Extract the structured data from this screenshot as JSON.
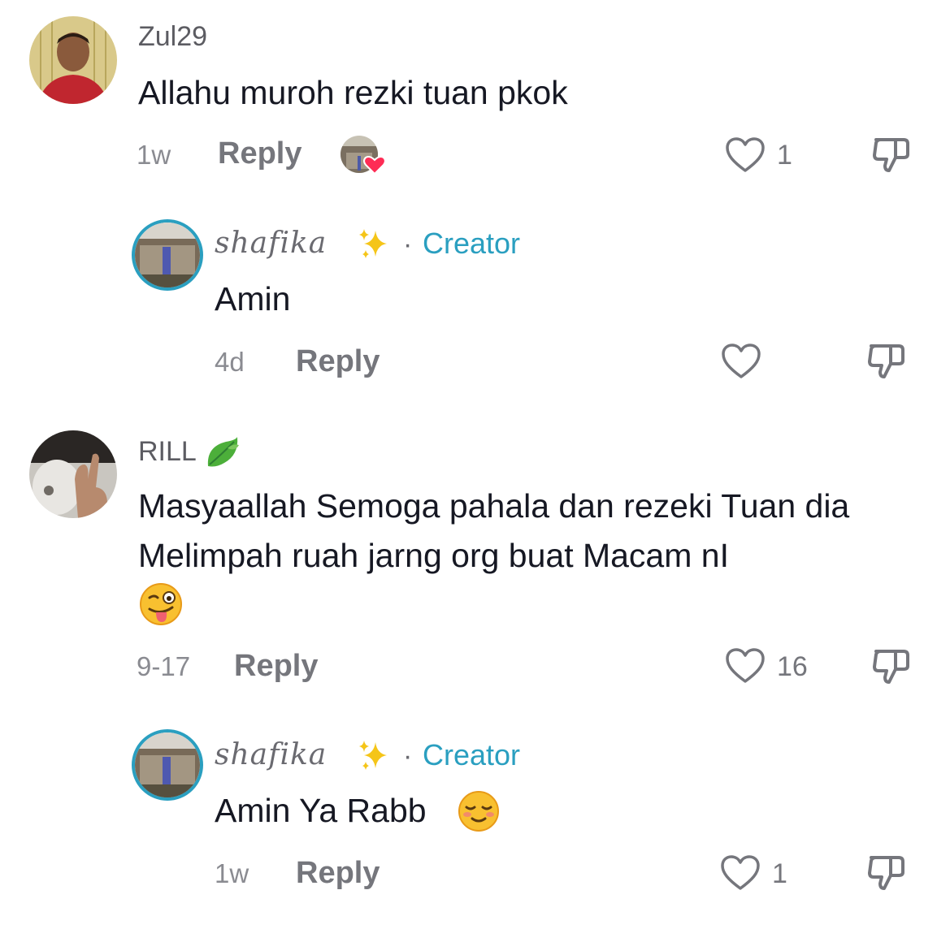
{
  "comments": [
    {
      "username": "Zul29",
      "text": "Allahu muroh rezki tuan pkok",
      "time": "1w",
      "reply_label": "Reply",
      "likes": "1",
      "liked_by_creator": true,
      "replies": [
        {
          "username": "shafika",
          "badge": "Creator",
          "separator": "·",
          "text": "Amin",
          "time": "4d",
          "reply_label": "Reply",
          "likes": ""
        }
      ]
    },
    {
      "username": "RILL",
      "text": "Masyaallah Semoga pahala dan rezeki Tuan dia Melimpah ruah jarng org buat Macam nI",
      "time": "9-17",
      "reply_label": "Reply",
      "likes": "16",
      "replies": [
        {
          "username": "shafika",
          "badge": "Creator",
          "separator": "·",
          "text": "Amin Ya Rabb",
          "time": "1w",
          "reply_label": "Reply",
          "likes": "1"
        }
      ]
    }
  ],
  "colors": {
    "creator_accent": "#2a9fc0",
    "heart_outline": "#75767c",
    "liked_heart": "#fe2c55"
  },
  "icons": [
    "heart-outline-icon",
    "thumbs-down-icon",
    "sparkles-icon",
    "leaf-icon",
    "winking-tongue-emoji",
    "smiling-blush-emoji"
  ]
}
